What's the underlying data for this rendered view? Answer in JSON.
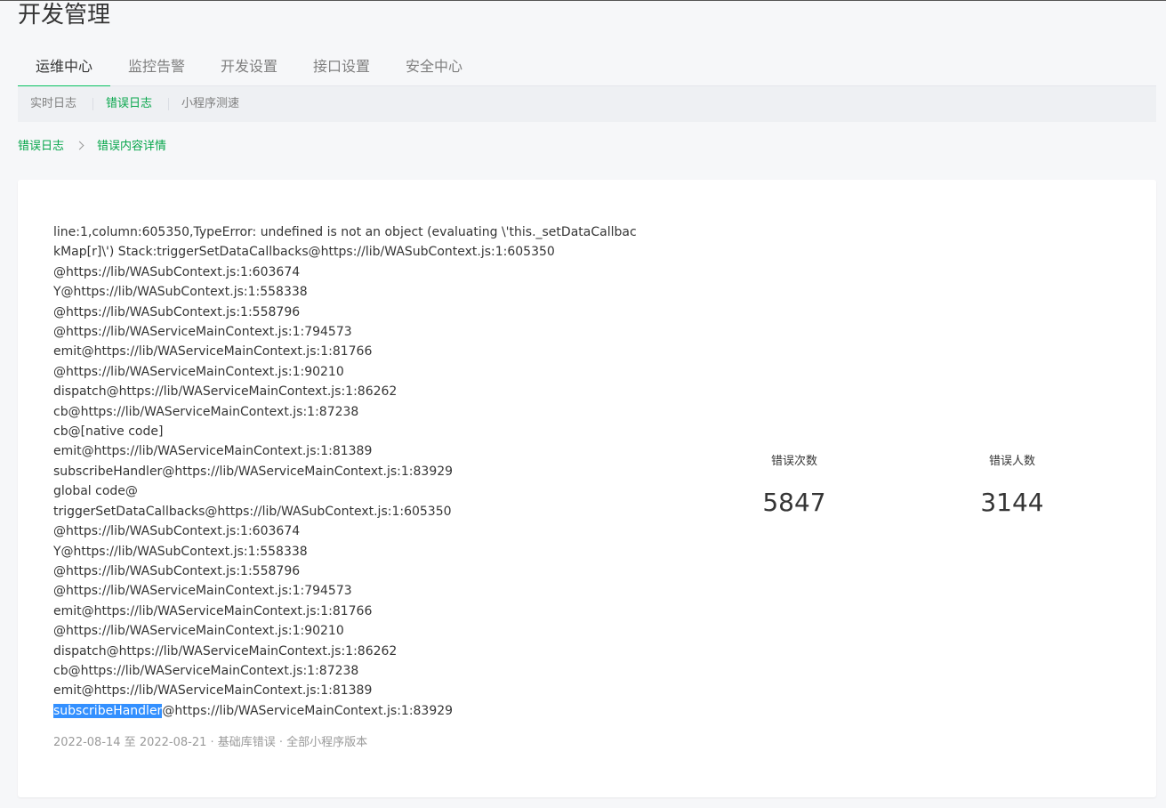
{
  "page": {
    "title": "开发管理"
  },
  "tabs": [
    {
      "label": "运维中心",
      "active": true
    },
    {
      "label": "监控告警",
      "active": false
    },
    {
      "label": "开发设置",
      "active": false
    },
    {
      "label": "接口设置",
      "active": false
    },
    {
      "label": "安全中心",
      "active": false
    }
  ],
  "subnav": [
    {
      "label": "实时日志",
      "active": false
    },
    {
      "label": "错误日志",
      "active": true
    },
    {
      "label": "小程序测速",
      "active": false
    }
  ],
  "breadcrumb": {
    "parent": "错误日志",
    "current": "错误内容详情"
  },
  "error": {
    "stack_lines": [
      "line:1,column:605350,TypeError: undefined is not an object (evaluating \\'this._setDataCallbac",
      "kMap[r]\\') Stack:triggerSetDataCallbacks@https://lib/WASubContext.js:1:605350",
      "@https://lib/WASubContext.js:1:603674",
      "Y@https://lib/WASubContext.js:1:558338",
      "@https://lib/WASubContext.js:1:558796",
      "@https://lib/WAServiceMainContext.js:1:794573",
      "emit@https://lib/WAServiceMainContext.js:1:81766",
      "@https://lib/WAServiceMainContext.js:1:90210",
      "dispatch@https://lib/WAServiceMainContext.js:1:86262",
      "cb@https://lib/WAServiceMainContext.js:1:87238",
      "cb@[native code]",
      "emit@https://lib/WAServiceMainContext.js:1:81389",
      "subscribeHandler@https://lib/WAServiceMainContext.js:1:83929",
      "global code@",
      "triggerSetDataCallbacks@https://lib/WASubContext.js:1:605350",
      "@https://lib/WASubContext.js:1:603674",
      "Y@https://lib/WASubContext.js:1:558338",
      "@https://lib/WASubContext.js:1:558796",
      "@https://lib/WAServiceMainContext.js:1:794573",
      "emit@https://lib/WAServiceMainContext.js:1:81766",
      "@https://lib/WAServiceMainContext.js:1:90210",
      "dispatch@https://lib/WAServiceMainContext.js:1:86262",
      "cb@https://lib/WAServiceMainContext.js:1:87238",
      "emit@https://lib/WAServiceMainContext.js:1:81389"
    ],
    "last_line_selected": "subscribeHandler",
    "last_line_rest": "@https://lib/WAServiceMainContext.js:1:83929",
    "meta": "2022-08-14 至  2022-08-21 ·  基础库错误 ·  全部小程序版本"
  },
  "metrics": {
    "error_count_label": "错误次数",
    "error_count": "5847",
    "error_users_label": "错误人数",
    "error_users": "3144"
  },
  "colors": {
    "accent": "#07c160",
    "accent_text": "#07a64b",
    "selection": "#3390ff"
  }
}
